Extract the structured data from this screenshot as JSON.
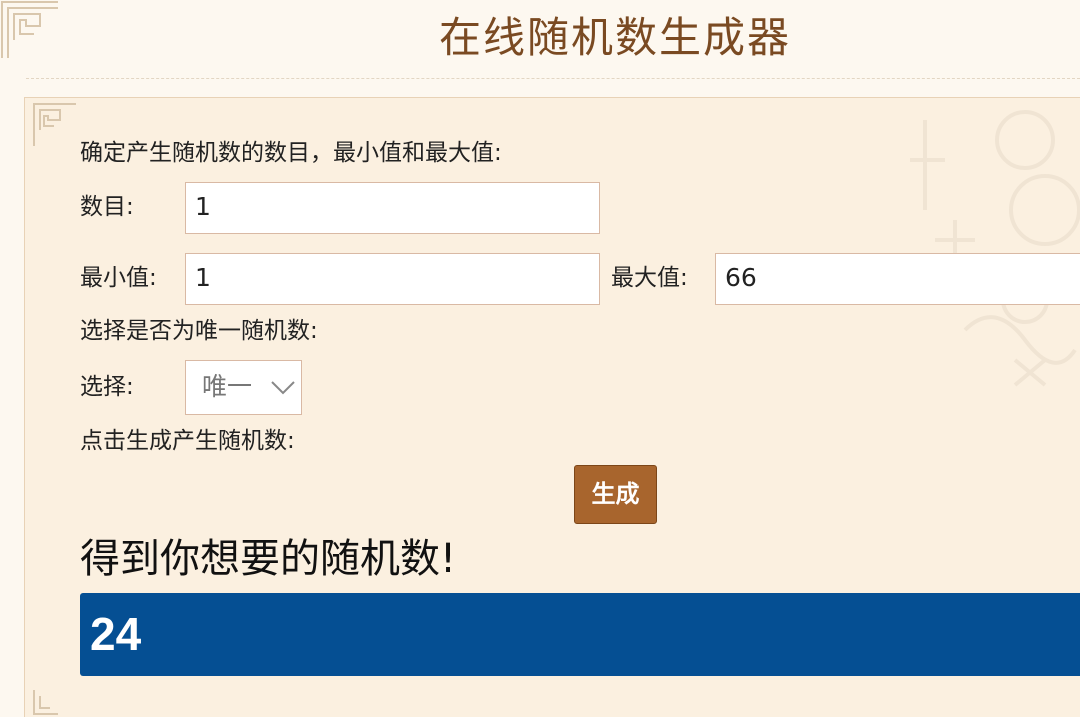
{
  "title": "在线随机数生成器",
  "form": {
    "intro": "确定产生随机数的数目，最小值和最大值:",
    "count_label": "数目:",
    "count_value": "1",
    "min_label": "最小值:",
    "min_value": "1",
    "max_label": "最大值:",
    "max_value": "66",
    "unique_prompt": "选择是否为唯一随机数:",
    "select_label": "选择:",
    "select_value": "唯一",
    "generate_prompt": "点击生成产生随机数:",
    "generate_button": "生成"
  },
  "result": {
    "heading": "得到你想要的随机数!",
    "value": "24"
  },
  "colors": {
    "page_bg": "#fdf8f0",
    "panel_bg": "#fbf0e0",
    "title": "#7a4a22",
    "button": "#a8652d",
    "result_bg": "#054f93",
    "input_border": "#d9b9a4"
  },
  "icons": {
    "select_arrow": "chevron-down-icon",
    "corner_decoration": "corner-ornament-icon"
  }
}
